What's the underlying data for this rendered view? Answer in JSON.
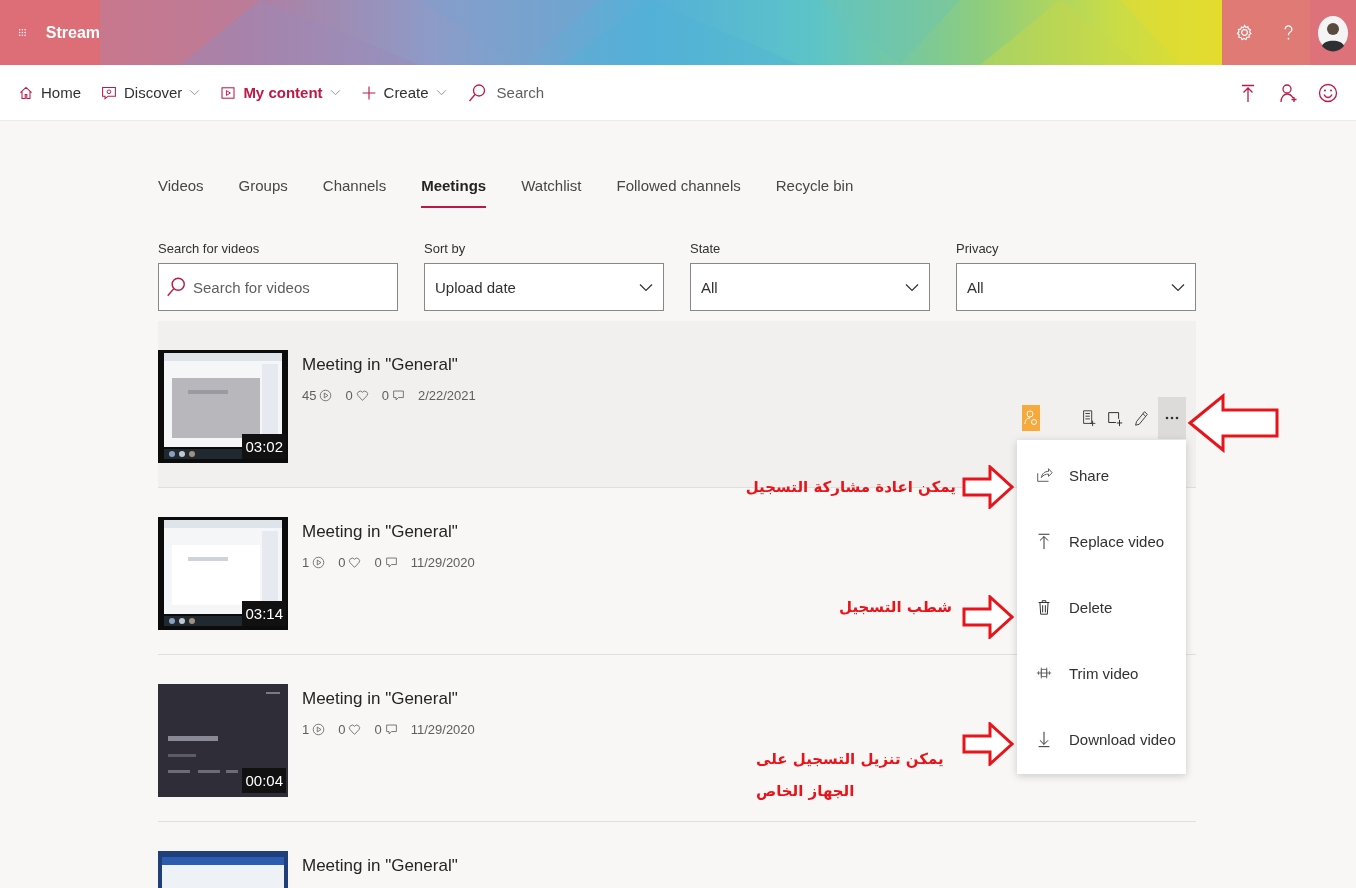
{
  "app": {
    "name": "Stream"
  },
  "nav": {
    "items": [
      {
        "label": "Home",
        "selected": false,
        "dropdown": false
      },
      {
        "label": "Discover",
        "selected": false,
        "dropdown": true
      },
      {
        "label": "My content",
        "selected": true,
        "dropdown": true
      },
      {
        "label": "Create",
        "selected": false,
        "dropdown": true
      }
    ],
    "search": {
      "placeholder": "Search"
    }
  },
  "tabs": [
    {
      "label": "Videos",
      "selected": false
    },
    {
      "label": "Groups",
      "selected": false
    },
    {
      "label": "Channels",
      "selected": false
    },
    {
      "label": "Meetings",
      "selected": true
    },
    {
      "label": "Watchlist",
      "selected": false
    },
    {
      "label": "Followed channels",
      "selected": false
    },
    {
      "label": "Recycle bin",
      "selected": false
    }
  ],
  "filters": [
    {
      "kind": "search",
      "label": "Search for videos",
      "placeholder": "Search for videos"
    },
    {
      "kind": "select",
      "label": "Sort by",
      "value": "Upload date"
    },
    {
      "kind": "select",
      "label": "State",
      "value": "All"
    },
    {
      "kind": "select",
      "label": "Privacy",
      "value": "All"
    }
  ],
  "videos": [
    {
      "title": "Meeting in \"General\"",
      "views": "45",
      "likes": "0",
      "comments": "0",
      "date": "2/22/2021",
      "duration": "03:02",
      "hovered": true,
      "menu_open": true
    },
    {
      "title": "Meeting in \"General\"",
      "views": "1",
      "likes": "0",
      "comments": "0",
      "date": "11/29/2020",
      "duration": "03:14",
      "hovered": false
    },
    {
      "title": "Meeting in \"General\"",
      "views": "1",
      "likes": "0",
      "comments": "0",
      "date": "11/29/2020",
      "duration": "00:04",
      "hovered": false
    },
    {
      "title": "Meeting in \"General\""
    }
  ],
  "context_menu": {
    "items": [
      {
        "label": "Share"
      },
      {
        "label": "Replace video"
      },
      {
        "label": "Delete"
      },
      {
        "label": "Trim video"
      },
      {
        "label": "Download video"
      }
    ]
  },
  "annotations": [
    {
      "text": "يمكن اعادة مشاركة التسجيل"
    },
    {
      "text": "شطب التسجيل"
    },
    {
      "text": "يمكن تنزيل التسجيل على الجهاز الخاص"
    }
  ]
}
